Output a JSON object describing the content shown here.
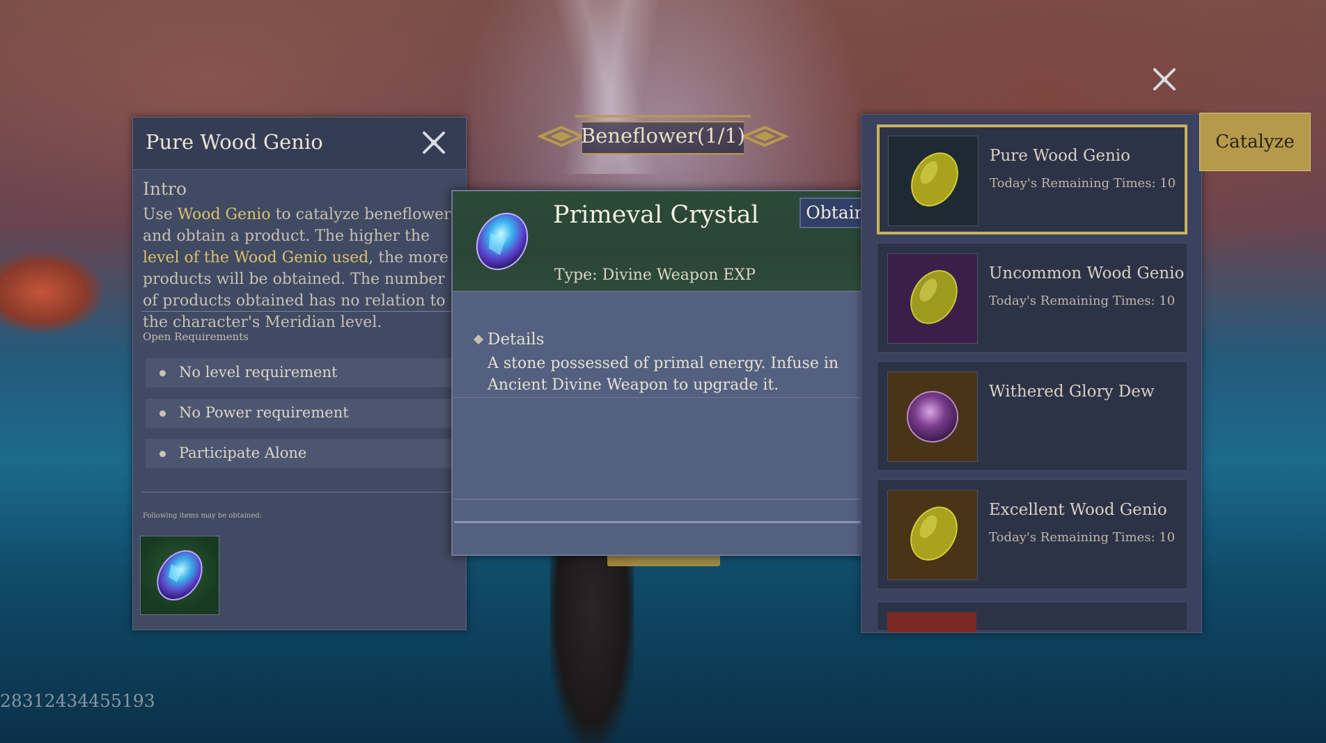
{
  "left_panel": {
    "title": "Pure Wood Genio",
    "intro_heading": "Intro",
    "intro_parts": {
      "p1": "Use ",
      "h1": "Wood Genio",
      "p2": " to catalyze beneflower and obtain a product. The higher the ",
      "h2": "level of the Wood Genio used",
      "p3": ", the more products will be obtained. The number of products obtained has no relation to the character's Meridian level."
    },
    "open_requirements_label": "Open Requirements",
    "requirements": [
      "No level requirement",
      "No Power requirement",
      "Participate Alone"
    ],
    "following_label": "Following items may be obtained:",
    "reward_icon": "primeval-crystal-icon"
  },
  "banner": {
    "title": "Beneflower(1/1)"
  },
  "tooltip": {
    "title": "Primeval Crystal",
    "obtain_label": "Obtain",
    "type": "Type: Divine Weapon EXP",
    "details_heading": "Details",
    "details_text": "A stone possessed of primal energy. Infuse in Ancient Divine Weapon to upgrade it."
  },
  "right_list": {
    "items": [
      {
        "name": "Pure Wood Genio",
        "sub": "Today's Remaining Times: 10",
        "selected": true,
        "thumb_color": "#1e2a32",
        "icon": "wood-genio-icon"
      },
      {
        "name": "Uncommon Wood Genio",
        "sub": "Today's Remaining Times: 10",
        "selected": false,
        "thumb_color": "#3b1f4a",
        "icon": "wood-genio-icon"
      },
      {
        "name": "Withered Glory Dew",
        "sub": "",
        "selected": false,
        "thumb_color": "#4a3418",
        "icon": "glory-dew-icon"
      },
      {
        "name": "Excellent Wood Genio",
        "sub": "Today's Remaining Times: 10",
        "selected": false,
        "thumb_color": "#4a3418",
        "icon": "wood-genio-icon"
      }
    ]
  },
  "catalyze_label": "Catalyze",
  "uid_text": "28312434455193",
  "colors": {
    "accent_gold": "#c9b35a",
    "highlight_text": "#d9c36a"
  }
}
